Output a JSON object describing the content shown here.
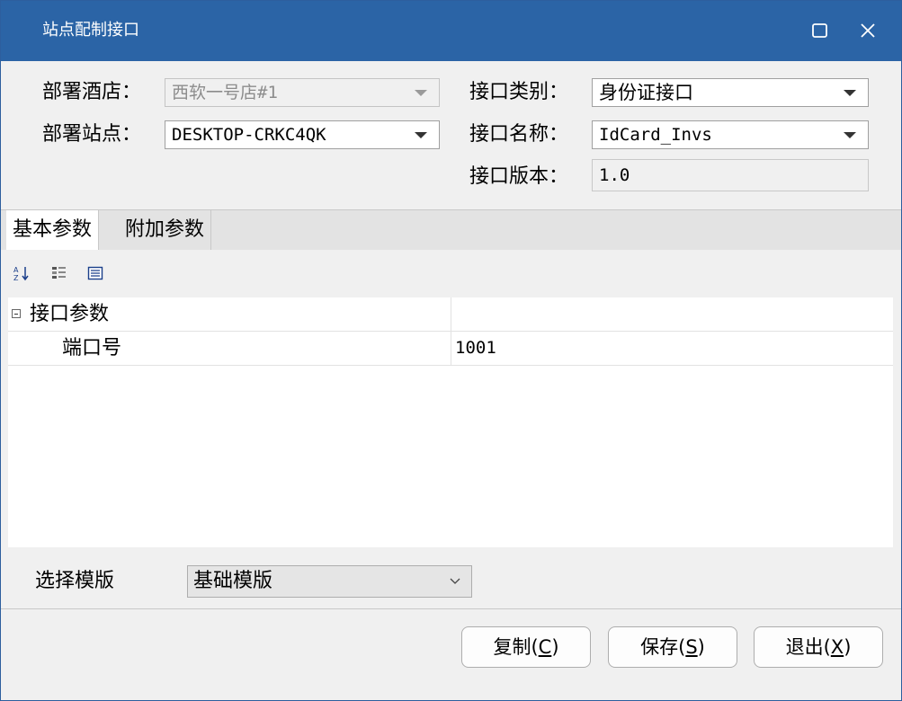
{
  "window": {
    "title": "站点配制接口"
  },
  "form": {
    "hotel_label": "部署酒店：",
    "hotel_value": "西软一号店#1",
    "site_label": "部署站点：",
    "site_value": "DESKTOP-CRKC4QK",
    "category_label": "接口类别：",
    "category_value": "身份证接口",
    "name_label": "接口名称：",
    "name_value": "IdCard_Invs",
    "version_label": "接口版本：",
    "version_value": "1.0"
  },
  "tabs": [
    {
      "label": "基本参数",
      "active": true
    },
    {
      "label": "附加参数",
      "active": false
    }
  ],
  "toolbar": {
    "icons": [
      "sort-alpha-icon",
      "categorized-icon",
      "property-pages-icon"
    ]
  },
  "grid": {
    "category": "接口参数",
    "rows": [
      {
        "name": "端口号",
        "value": "1001"
      }
    ]
  },
  "template": {
    "label": "选择模版",
    "value": "基础模版"
  },
  "buttons": {
    "copy_text": "复制(",
    "copy_key": "C",
    "save_text": "保存(",
    "save_key": "S",
    "exit_text": "退出(",
    "exit_key": "X",
    "close_paren": ")"
  },
  "colors": {
    "titlebar": "#2b64a6",
    "window_bg": "#f0f0f0"
  }
}
